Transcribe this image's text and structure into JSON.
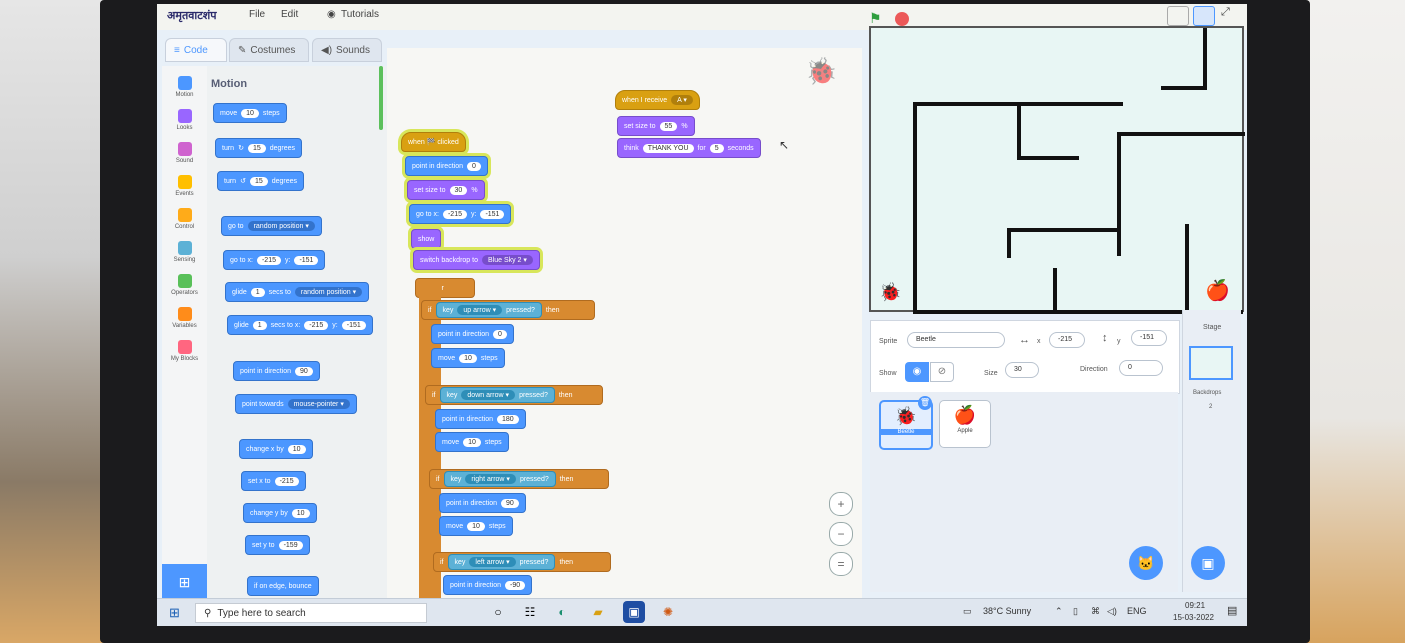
{
  "menubar": {
    "logo": "अमृतवाटशंप",
    "file": "File",
    "edit": "Edit",
    "tutorials": "Tutorials"
  },
  "tabs": {
    "code": "Code",
    "costumes": "Costumes",
    "sounds": "Sounds"
  },
  "categories": [
    "Motion",
    "Looks",
    "Sound",
    "Events",
    "Control",
    "Sensing",
    "Operators",
    "Variables",
    "My Blocks"
  ],
  "category_colors": [
    "#4c97ff",
    "#9966ff",
    "#cf63cf",
    "#ffbf00",
    "#ffab19",
    "#5cb1d6",
    "#59c059",
    "#ff8c1a",
    "#ff6680"
  ],
  "palette": {
    "title": "Motion",
    "move": "move",
    "move_val": "10",
    "steps": "steps",
    "turn_cw": "turn",
    "turn_cw_val": "15",
    "degrees": "degrees",
    "turn_ccw": "turn",
    "turn_ccw_val": "15",
    "goto": "go to",
    "goto_opt": "random position ▾",
    "gotoxy": "go to x:",
    "gotoxy_x": "-215",
    "y": "y:",
    "gotoxy_y": "-151",
    "glide": "glide",
    "glide_val": "1",
    "secs_to": "secs to",
    "glide_opt": "random position ▾",
    "glidexy": "glide",
    "glidexy_val": "1",
    "secs_to_x": "secs to x:",
    "glidexy_x": "-215",
    "glidexy_y": "-151",
    "point_dir": "point in direction",
    "point_dir_val": "90",
    "point_towards": "point towards",
    "point_towards_opt": "mouse-pointer ▾",
    "change_x": "change x by",
    "change_x_val": "10",
    "set_x": "set x to",
    "set_x_val": "-215",
    "change_y": "change y by",
    "change_y_val": "10",
    "set_y": "set y to",
    "set_y_val": "-159",
    "edge_bounce": "if on edge, bounce"
  },
  "script_main": {
    "hat": "when 🏁 clicked",
    "point1": "point in direction",
    "point1_val": "0",
    "setsize": "set size to",
    "setsize_val": "30",
    "pct": "%",
    "gotoxy": "go to x:",
    "gotoxy_x": "-215",
    "y": "y:",
    "gotoxy_y": "-151",
    "show": "show",
    "backdrop": "switch backdrop to",
    "backdrop_opt": "Blue Sky 2 ▾",
    "forever": "forever",
    "if": "if",
    "then": "then",
    "key": "key",
    "pressed": "pressed?",
    "k_up": "up arrow ▾",
    "up_dir": "0",
    "k_down": "down arrow ▾",
    "down_dir": "180",
    "k_right": "right arrow ▾",
    "right_dir": "90",
    "k_left": "left arrow ▾",
    "left_dir": "-90",
    "point": "point in direction",
    "move": "move",
    "move_val": "10",
    "steps": "steps"
  },
  "script_receive": {
    "hat": "when I receive",
    "hat_opt": "A ▾",
    "setsize": "set size to",
    "setsize_val": "55",
    "pct": "%",
    "think": "think",
    "think_val": "THANK YOU",
    "for": "for",
    "for_val": "5",
    "seconds": "seconds"
  },
  "sprite_panel": {
    "sprite_label": "Sprite",
    "sprite_name": "Beetle",
    "x_label": "x",
    "x_val": "-215",
    "y_label": "y",
    "y_val": "-151",
    "show_label": "Show",
    "size_label": "Size",
    "size_val": "30",
    "direction_label": "Direction",
    "direction_val": "0"
  },
  "sprites": [
    "Beetle",
    "Apple"
  ],
  "stage_pane": {
    "title": "Stage",
    "backdrops_label": "Backdrops",
    "backdrops_count": "2"
  },
  "zoom": {
    "in": "+",
    "out": "−",
    "reset": "="
  },
  "taskbar": {
    "search_placeholder": "Type here to search",
    "weather": "38°C  Sunny",
    "lang": "ENG",
    "time": "09:21",
    "date": "15-03-2022"
  }
}
